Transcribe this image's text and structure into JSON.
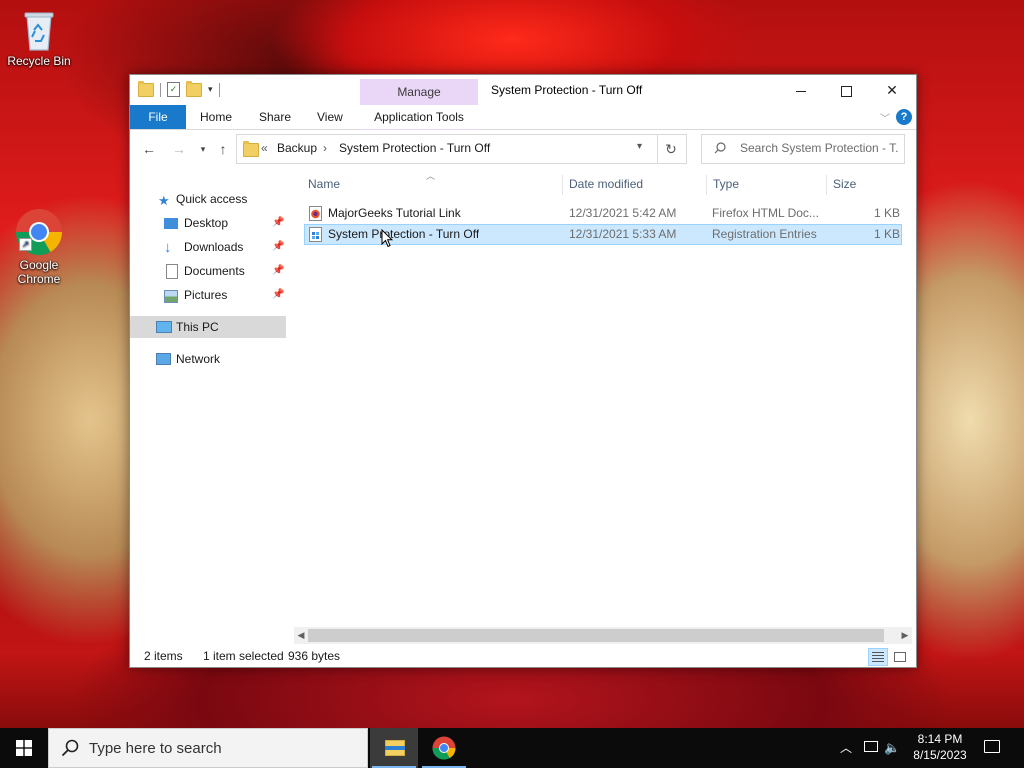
{
  "desktop": {
    "icons": [
      {
        "label": "Recycle Bin"
      },
      {
        "label": "Google Chrome"
      }
    ]
  },
  "window": {
    "title": "System Protection - Turn Off",
    "contextual_tab_group": "Manage",
    "ribbon_tabs": [
      "File",
      "Home",
      "Share",
      "View",
      "Application Tools"
    ],
    "breadcrumb": [
      "«",
      "Backup",
      "System Protection - Turn Off"
    ],
    "search_placeholder": "Search System Protection - T...",
    "nav": [
      {
        "label": "Quick access"
      },
      {
        "label": "Desktop",
        "pinned": true
      },
      {
        "label": "Downloads",
        "pinned": true
      },
      {
        "label": "Documents",
        "pinned": true
      },
      {
        "label": "Pictures",
        "pinned": true
      },
      {
        "label": "This PC"
      },
      {
        "label": "Network"
      }
    ],
    "columns": [
      "Name",
      "Date modified",
      "Type",
      "Size"
    ],
    "files": [
      {
        "name": "MajorGeeks Tutorial Link",
        "date": "12/31/2021 5:42 AM",
        "type": "Firefox HTML Doc...",
        "size": "1 KB"
      },
      {
        "name": "System Protection - Turn Off",
        "date": "12/31/2021 5:33 AM",
        "type": "Registration Entries",
        "size": "1 KB"
      }
    ],
    "status": {
      "items": "2 items",
      "selected": "1 item selected",
      "bytes": "936 bytes"
    }
  },
  "taskbar": {
    "search_placeholder": "Type here to search",
    "time": "8:14 PM",
    "date": "8/15/2023"
  },
  "colors": {
    "accent": "#1979ca",
    "selection": "#cce8ff",
    "manage_tab": "#ead6f7"
  }
}
